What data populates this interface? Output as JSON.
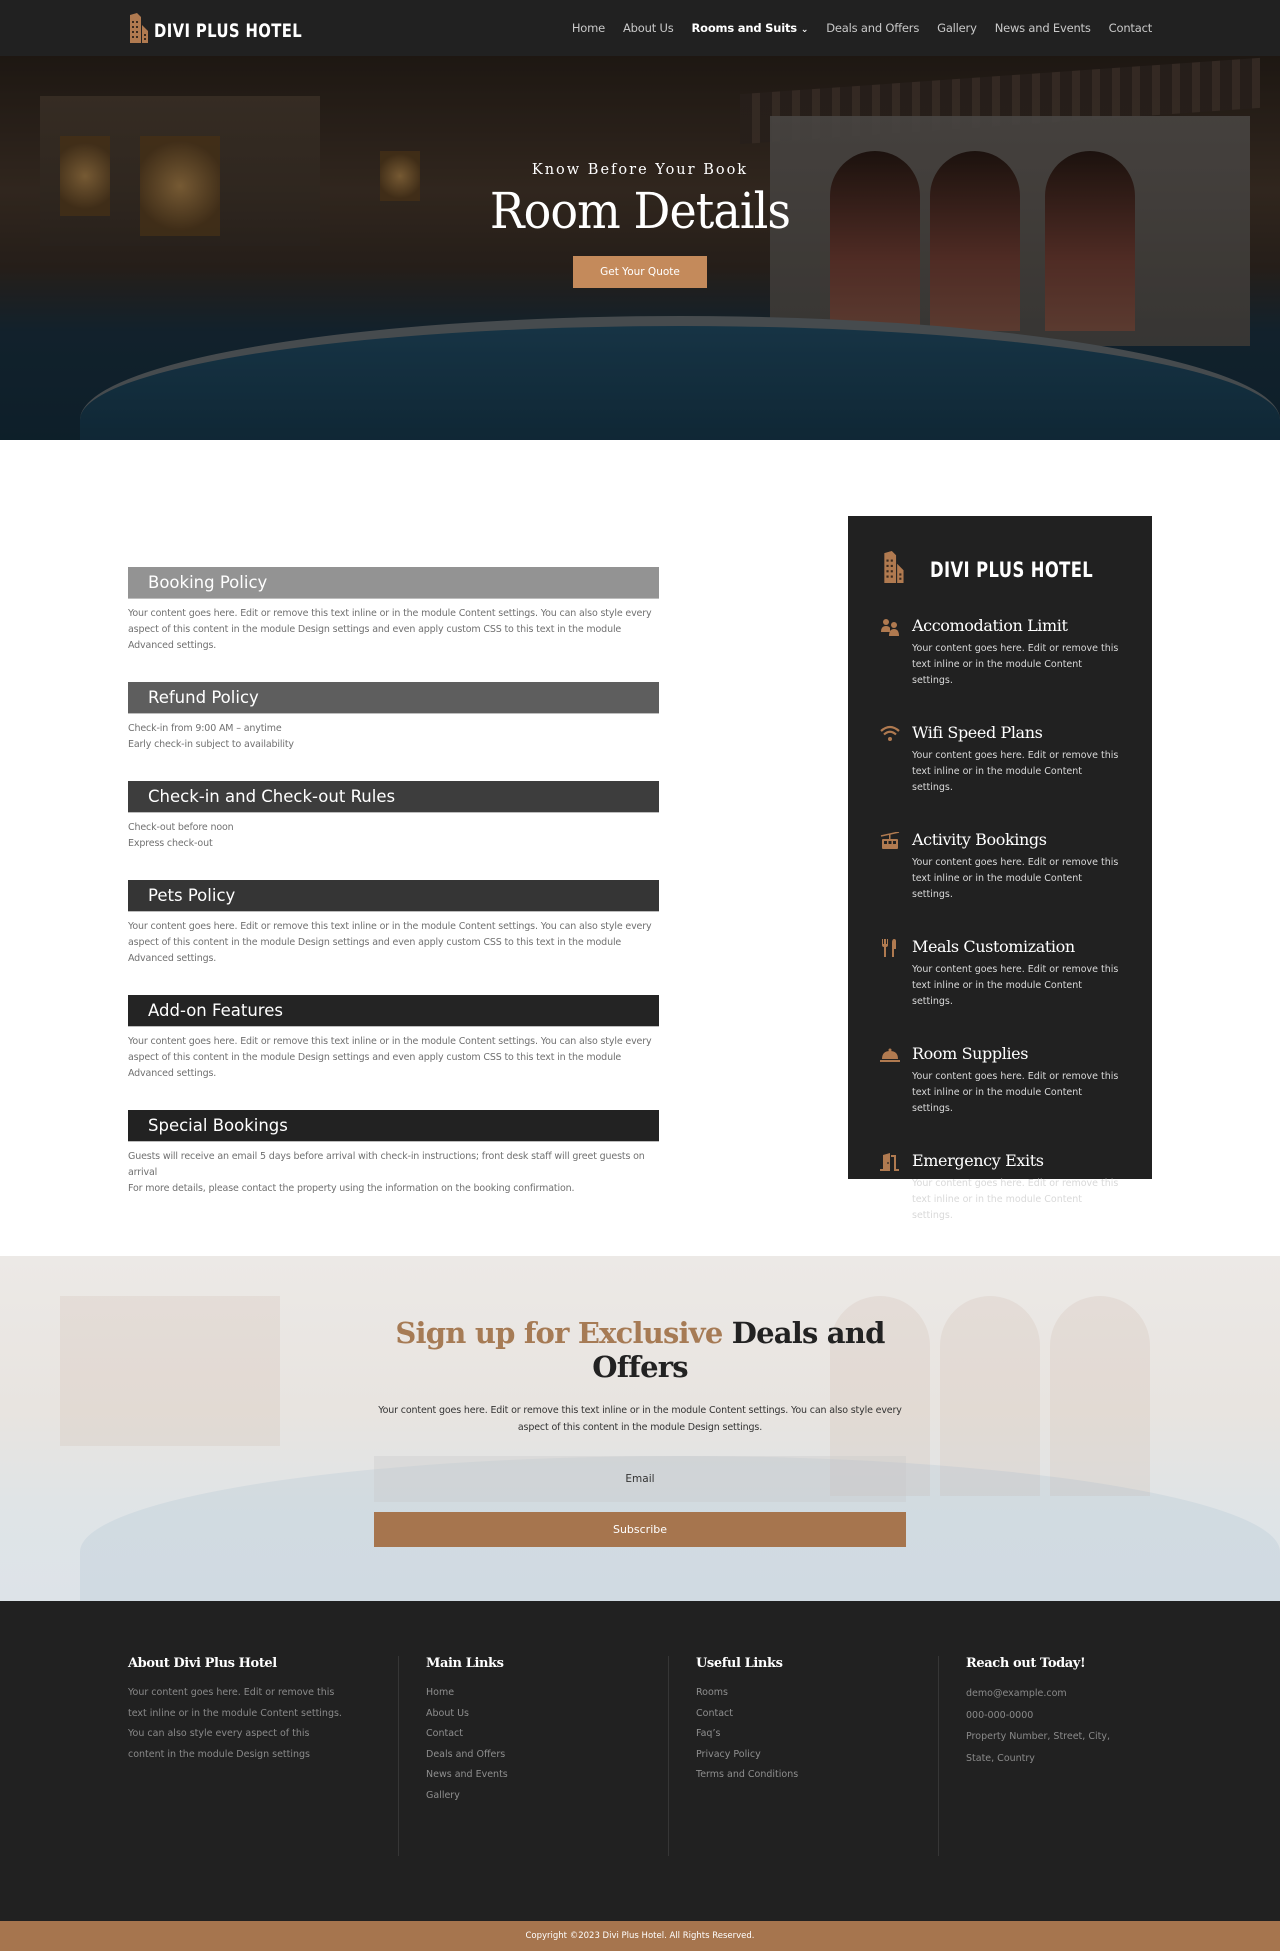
{
  "brand": {
    "name": "DIVI PLUS HOTEL",
    "accent_color": "#a6754e",
    "dark_color": "#212121"
  },
  "nav": {
    "items": [
      {
        "label": "Home",
        "active": false
      },
      {
        "label": "About Us",
        "active": false
      },
      {
        "label": "Rooms and Suits",
        "active": true,
        "has_dropdown": true
      },
      {
        "label": "Deals and Offers",
        "active": false
      },
      {
        "label": "Gallery",
        "active": false
      },
      {
        "label": "News and Events",
        "active": false
      },
      {
        "label": "Contact",
        "active": false
      }
    ],
    "dropdown_icon": "chevron-down-icon"
  },
  "hero": {
    "subtitle": "Know Before Your Book",
    "title": "Room Details",
    "button_label": "Get Your Quote"
  },
  "policies": [
    {
      "title": "Booking Policy",
      "color": "#939393",
      "lines": [
        "Your content goes here. Edit or remove this text inline or in the module Content settings. You can also style every aspect of this content in the module Design settings and even apply custom CSS to this text in the module Advanced settings."
      ]
    },
    {
      "title": "Refund Policy",
      "color": "#5e5e5e",
      "lines": [
        "Check-in from 9:00 AM – anytime",
        "Early check-in subject to availability"
      ]
    },
    {
      "title": "Check-in and Check-out Rules",
      "color": "#3d3d3d",
      "lines": [
        "Check-out before noon",
        "Express check-out"
      ]
    },
    {
      "title": "Pets Policy",
      "color": "#353535",
      "lines": [
        "Your content goes here. Edit or remove this text inline or in the module Content settings. You can also style every aspect of this content in the module Design settings and even apply custom CSS to this text in the module Advanced settings."
      ]
    },
    {
      "title": "Add-on Features",
      "color": "#242424",
      "lines": [
        "Your content goes here. Edit or remove this text inline or in the module Content settings. You can also style every aspect of this content in the module Design settings and even apply custom CSS to this text in the module Advanced settings."
      ]
    },
    {
      "title": "Special Bookings",
      "color": "#222222",
      "lines": [
        "Guests will receive an email 5 days before arrival with check-in instructions; front desk staff will greet guests on arrival",
        "For more details, please contact the property using the information on the booking confirmation."
      ]
    }
  ],
  "side_panel": {
    "logo_text": "DIVI PLUS HOTEL",
    "features": [
      {
        "icon": "users-icon",
        "title": "Accomodation Limit",
        "text": "Your content goes here. Edit or remove this text inline or in the module Content settings."
      },
      {
        "icon": "wifi-icon",
        "title": "Wifi Speed Plans",
        "text": "Your content goes here. Edit or remove this text inline or in the module Content settings."
      },
      {
        "icon": "cable-car-icon",
        "title": "Activity Bookings",
        "text": "Your content goes here. Edit or remove this text inline or in the module Content settings."
      },
      {
        "icon": "utensils-icon",
        "title": "Meals Customization",
        "text": "Your content goes here. Edit or remove this text inline or in the module Content settings."
      },
      {
        "icon": "service-bell-icon",
        "title": "Room Supplies",
        "text": "Your content goes here. Edit or remove this text inline or in the module Content settings."
      },
      {
        "icon": "door-open-icon",
        "title": "Emergency Exits",
        "text": "Your content goes here. Edit or remove this text inline or in the module Content settings."
      }
    ]
  },
  "signup": {
    "title_accent": "Sign up for Exclusive",
    "title_rest": "Deals and Offers",
    "text": "Your content goes here. Edit or remove this text inline or in the module Content settings. You can also style every aspect of this content in the module Design settings.",
    "email_placeholder": "Email",
    "button_label": "Subscribe"
  },
  "footer": {
    "about": {
      "heading": "About Divi Plus Hotel",
      "text": "Your content goes here. Edit or remove this text inline or in the module Content settings. You can also style every aspect of this content in the module Design settings"
    },
    "main_links": {
      "heading": "Main Links",
      "links": [
        "Home",
        "About Us",
        "Contact",
        "Deals and Offers",
        "News and Events",
        "Gallery"
      ]
    },
    "useful_links": {
      "heading": "Useful Links",
      "links": [
        "Rooms",
        "Contact",
        "Faq’s",
        "Privacy Policy",
        "Terms and Conditions"
      ]
    },
    "contact": {
      "heading": "Reach out Today!",
      "email": "demo@example.com",
      "phone": "000-000-0000",
      "address_line1": "Property Number, Street, City,",
      "address_line2": "State, Country"
    },
    "copyright": "Copyright ©2023 Divi Plus Hotel. All Rights Reserved."
  }
}
